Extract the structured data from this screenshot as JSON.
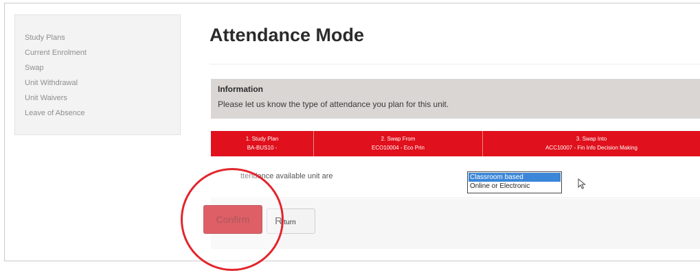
{
  "sidebar": {
    "items": [
      {
        "label": "Study Plans"
      },
      {
        "label": "Current Enrolment"
      },
      {
        "label": "Swap"
      },
      {
        "label": "Unit Withdrawal"
      },
      {
        "label": "Unit Waivers"
      },
      {
        "label": "Leave of Absence"
      }
    ]
  },
  "page": {
    "title": "Attendance Mode"
  },
  "information": {
    "heading": "Information",
    "text": "Please let us know the type of attendance you plan for this unit."
  },
  "steps": [
    {
      "title": "1. Study Plan",
      "value": "BA-BUS10 -"
    },
    {
      "title": "2. Swap From",
      "value": "ECO10004 - Eco Prin"
    },
    {
      "title": "3. Swap Into",
      "value": "ACC10007 - Fin Info Decision Making"
    }
  ],
  "attendance": {
    "question": "ttendance available unit are",
    "options": [
      "Classroom based",
      "Online or Electronic"
    ],
    "selected": "Classroom based"
  },
  "buttons": {
    "confirm": "Confirm",
    "return_first": "R",
    "return_rest": "eturn"
  },
  "colors": {
    "accent": "#e0101c",
    "confirm": "#cc0a14",
    "highlight": "#e3242b",
    "selected_option": "#3b86d8"
  }
}
